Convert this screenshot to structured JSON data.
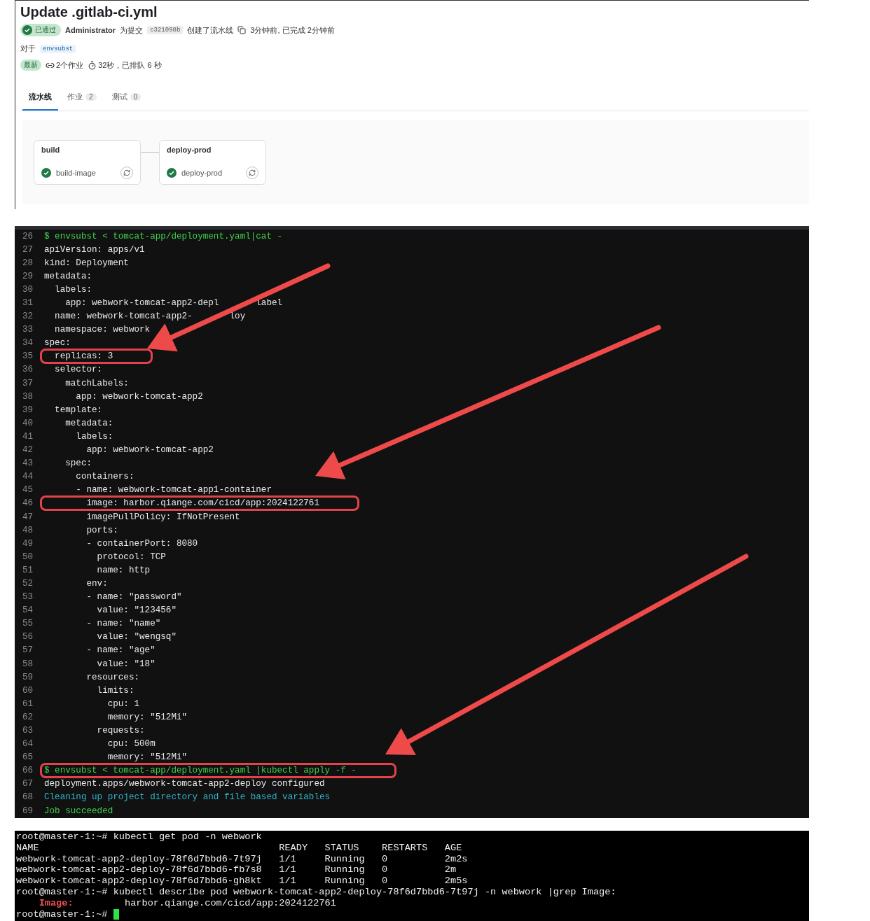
{
  "pipeline": {
    "title": "Update .gitlab-ci.yml",
    "status": {
      "kind": "passed",
      "label": "已通过"
    },
    "author": "Administrator",
    "commit_prefix": "为提交",
    "sha": "c321098b",
    "action": "创建了流水线",
    "time": "3分钟前, 已完成 2分钟前",
    "ref_prefix": "对于",
    "ref": "envsubst",
    "latest": "最新",
    "jobs": "2个作业",
    "duration": "32秒，已排队 6 秒"
  },
  "tabs": [
    {
      "label": "流水线",
      "selected": true
    },
    {
      "label": "作业",
      "count": "2",
      "selected": false
    },
    {
      "label": "测试",
      "count": "0",
      "selected": false
    }
  ],
  "stages": [
    {
      "name": "build",
      "job": "build-image"
    },
    {
      "name": "deploy-prod",
      "job": "deploy-prod"
    }
  ],
  "log": [
    {
      "n": "26",
      "text": "$ envsubst < tomcat-app/deployment.yaml|cat -",
      "kind": "command",
      "highlighted": false
    },
    {
      "n": "27",
      "text": "apiVersion: apps/v1",
      "kind": "plain",
      "highlighted": false
    },
    {
      "n": "28",
      "text": "kind: Deployment",
      "kind": "plain",
      "highlighted": false
    },
    {
      "n": "29",
      "text": "metadata:",
      "kind": "plain",
      "highlighted": false
    },
    {
      "n": "30",
      "text": "  labels:",
      "kind": "plain",
      "highlighted": false
    },
    {
      "n": "31",
      "text": "    app: webwork-tomcat-app2-depl",
      "tail": "label",
      "kind": "plain",
      "highlighted": false
    },
    {
      "n": "32",
      "text": "  name: webwork-tomcat-app2-",
      "tail": "loy",
      "kind": "plain",
      "highlighted": false
    },
    {
      "n": "33",
      "text": "  namespace: webwork",
      "kind": "plain",
      "highlighted": false
    },
    {
      "n": "34",
      "text": "spec:",
      "kind": "plain",
      "highlighted": false
    },
    {
      "n": "35",
      "text": "  replicas: 3",
      "kind": "plain",
      "highlighted": true
    },
    {
      "n": "36",
      "text": "  selector:",
      "kind": "plain",
      "highlighted": false
    },
    {
      "n": "37",
      "text": "    matchLabels:",
      "kind": "plain",
      "highlighted": false
    },
    {
      "n": "38",
      "text": "      app: webwork-tomcat-app2",
      "kind": "plain",
      "highlighted": false
    },
    {
      "n": "39",
      "text": "  template:",
      "kind": "plain",
      "highlighted": false
    },
    {
      "n": "40",
      "text": "    metadata:",
      "kind": "plain",
      "highlighted": false
    },
    {
      "n": "41",
      "text": "      labels:",
      "kind": "plain",
      "highlighted": false
    },
    {
      "n": "42",
      "text": "        app: webwork-tomcat-app2",
      "kind": "plain",
      "highlighted": false
    },
    {
      "n": "43",
      "text": "    spec:",
      "kind": "plain",
      "highlighted": false
    },
    {
      "n": "44",
      "text": "      containers:",
      "kind": "plain",
      "highlighted": false
    },
    {
      "n": "45",
      "text": "      - name: webwork-tomcat-app1-container",
      "kind": "plain",
      "highlighted": false
    },
    {
      "n": "46",
      "text": "        image: harbor.qiange.com/cicd/app:2024122761",
      "kind": "plain",
      "highlighted": true
    },
    {
      "n": "47",
      "text": "        imagePullPolicy: IfNotPresent",
      "kind": "plain",
      "highlighted": false
    },
    {
      "n": "48",
      "text": "        ports:",
      "kind": "plain",
      "highlighted": false
    },
    {
      "n": "49",
      "text": "        - containerPort: 8080",
      "kind": "plain",
      "highlighted": false
    },
    {
      "n": "50",
      "text": "          protocol: TCP",
      "kind": "plain",
      "highlighted": false
    },
    {
      "n": "51",
      "text": "          name: http",
      "kind": "plain",
      "highlighted": false
    },
    {
      "n": "52",
      "text": "        env:",
      "kind": "plain",
      "highlighted": false
    },
    {
      "n": "53",
      "text": "        - name: \"password\"",
      "kind": "plain",
      "highlighted": false
    },
    {
      "n": "54",
      "text": "          value: \"123456\"",
      "kind": "plain",
      "highlighted": false
    },
    {
      "n": "55",
      "text": "        - name: \"name\"",
      "kind": "plain",
      "highlighted": false
    },
    {
      "n": "56",
      "text": "          value: \"wengsq\"",
      "kind": "plain",
      "highlighted": false
    },
    {
      "n": "57",
      "text": "        - name: \"age\"",
      "kind": "plain",
      "highlighted": false
    },
    {
      "n": "58",
      "text": "          value: \"18\"",
      "kind": "plain",
      "highlighted": false
    },
    {
      "n": "59",
      "text": "        resources:",
      "kind": "plain",
      "highlighted": false
    },
    {
      "n": "60",
      "text": "          limits:",
      "kind": "plain",
      "highlighted": false
    },
    {
      "n": "61",
      "text": "            cpu: 1",
      "kind": "plain",
      "highlighted": false
    },
    {
      "n": "62",
      "text": "            memory: \"512Mi\"",
      "kind": "plain",
      "highlighted": false
    },
    {
      "n": "63",
      "text": "          requests:",
      "kind": "plain",
      "highlighted": false
    },
    {
      "n": "64",
      "text": "            cpu: 500m",
      "kind": "plain",
      "highlighted": false
    },
    {
      "n": "65",
      "text": "            memory: \"512Mi\"",
      "kind": "plain",
      "highlighted": false
    },
    {
      "n": "66",
      "text": "$ envsubst < tomcat-app/deployment.yaml |kubectl apply -f -",
      "kind": "command",
      "highlighted": true
    },
    {
      "n": "67",
      "text": "deployment.apps/webwork-tomcat-app2-deploy configured",
      "kind": "plain",
      "highlighted": false
    },
    {
      "n": "68",
      "text": "Cleaning up project directory and file based variables",
      "kind": "info",
      "highlighted": false
    },
    {
      "n": "69",
      "text": "Job succeeded",
      "kind": "success",
      "highlighted": false
    }
  ],
  "terminal": [
    {
      "kind": "plain",
      "text": "root@master-1:~# kubectl get pod -n webwork"
    },
    {
      "kind": "plain",
      "text": "NAME                                          READY   STATUS    RESTARTS   AGE"
    },
    {
      "kind": "plain",
      "text": "webwork-tomcat-app2-deploy-78f6d7bbd6-7t97j   1/1     Running   0          2m2s"
    },
    {
      "kind": "plain",
      "text": "webwork-tomcat-app2-deploy-78f6d7bbd6-fb7s8   1/1     Running   0          2m"
    },
    {
      "kind": "plain",
      "text": "webwork-tomcat-app2-deploy-78f6d7bbd6-gh8kt   1/1     Running   0          2m5s"
    },
    {
      "kind": "plain",
      "text": "root@master-1:~# kubectl describe pod webwork-tomcat-app2-deploy-78f6d7bbd6-7t97j -n webwork |grep Image:"
    },
    {
      "kind": "match",
      "key": "Image:",
      "text": "harbor.qiange.com/cicd/app:2024122761"
    },
    {
      "kind": "prompt",
      "text": "root@master-1:~# "
    }
  ]
}
